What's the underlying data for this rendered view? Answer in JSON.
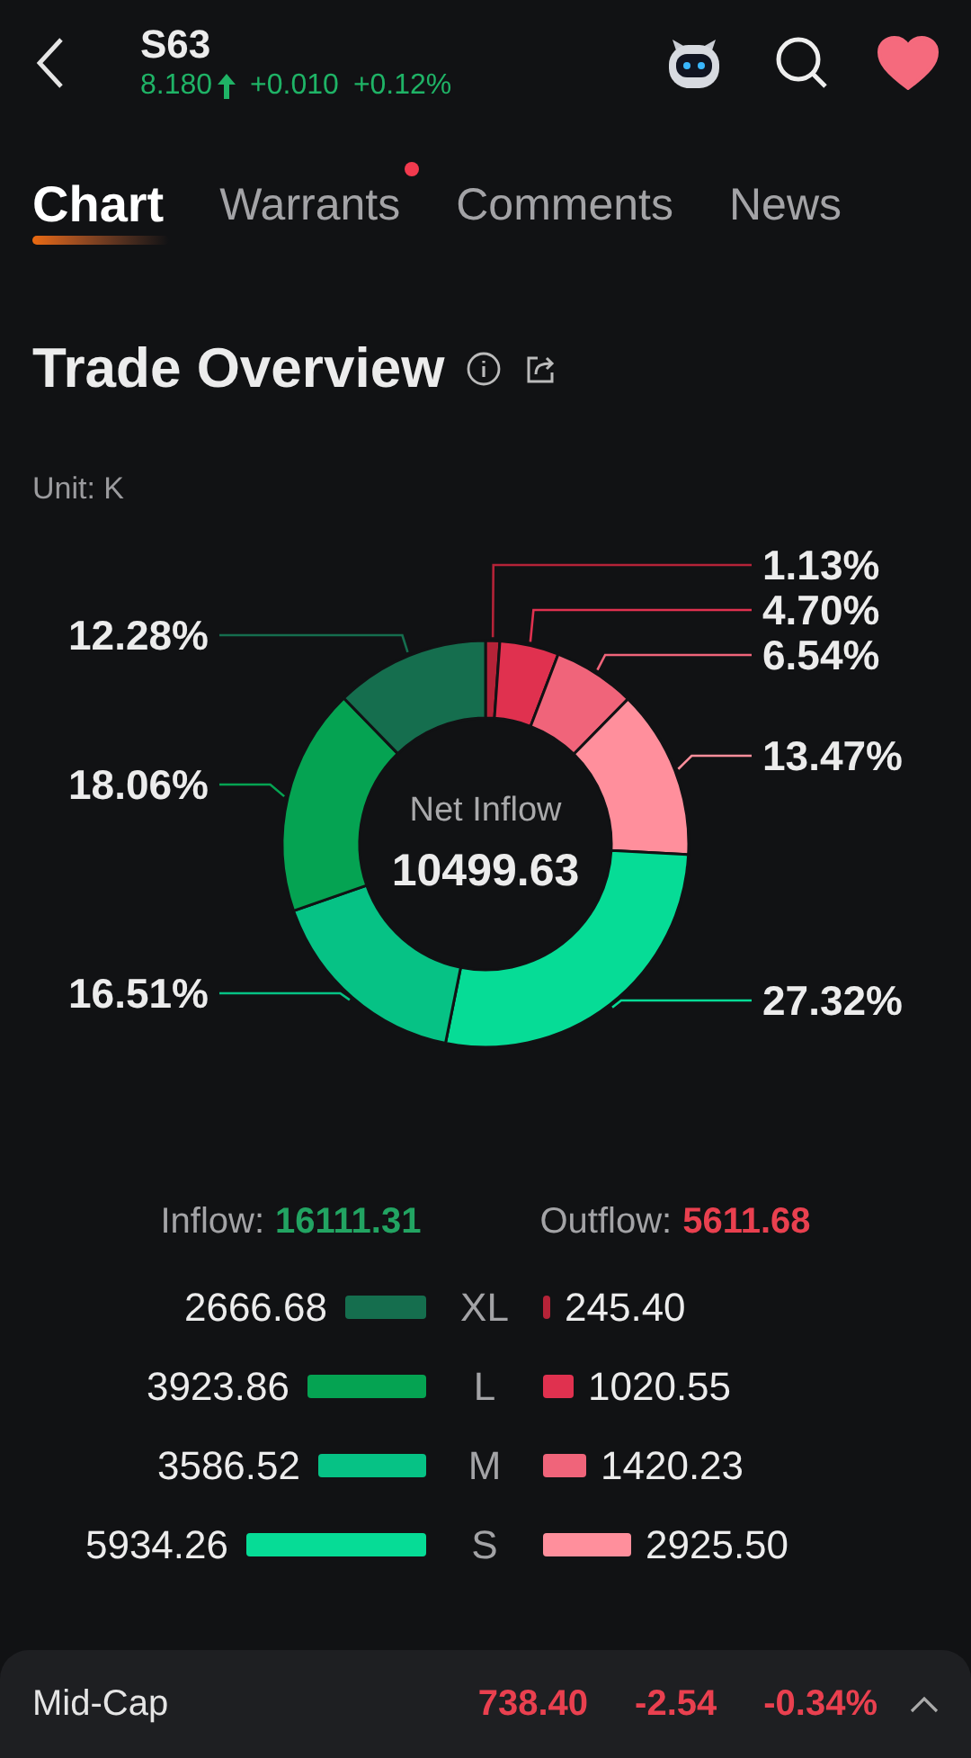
{
  "header": {
    "symbol": "S63",
    "price": "8.180",
    "change": "+0.010",
    "change_pct": "+0.12%",
    "favorite": true
  },
  "tabs": [
    {
      "label": "Chart",
      "selected": true,
      "dot": false
    },
    {
      "label": "Warrants",
      "selected": false,
      "dot": true
    },
    {
      "label": "Comments",
      "selected": false,
      "dot": false
    },
    {
      "label": "News",
      "selected": false,
      "dot": false
    }
  ],
  "section": {
    "title": "Trade Overview",
    "unit": "Unit: K"
  },
  "net_inflow": {
    "label": "Net Inflow",
    "value": "10499.63"
  },
  "chart_data": {
    "type": "donut",
    "values": [
      1.13,
      4.7,
      6.54,
      13.47,
      27.32,
      16.51,
      18.06,
      12.28
    ],
    "value_labels": [
      "1.13%",
      "4.70%",
      "6.54%",
      "13.47%",
      "27.32%",
      "16.51%",
      "18.06%",
      "12.28%"
    ],
    "colors": [
      "#b52338",
      "#e0314f",
      "#f0647a",
      "#ff8f9c",
      "#06dc96",
      "#06c285",
      "#05a352",
      "#156e4e"
    ]
  },
  "totals": {
    "inflow_label": "Inflow:",
    "inflow": "16111.31",
    "outflow_label": "Outflow:",
    "outflow": "5611.68"
  },
  "rows": [
    {
      "size": "XL",
      "inflow": {
        "value": "2666.68",
        "color": "#156e4e"
      },
      "outflow": {
        "value": "245.40",
        "color": "#b52338"
      }
    },
    {
      "size": "L",
      "inflow": {
        "value": "3923.86",
        "color": "#05a352"
      },
      "outflow": {
        "value": "1020.55",
        "color": "#e0314f"
      }
    },
    {
      "size": "M",
      "inflow": {
        "value": "3586.52",
        "color": "#06c285"
      },
      "outflow": {
        "value": "1420.23",
        "color": "#f0647a"
      }
    },
    {
      "size": "S",
      "inflow": {
        "value": "5934.26",
        "color": "#06dc96"
      },
      "outflow": {
        "value": "2925.50",
        "color": "#ff8f9c"
      }
    }
  ],
  "bottom_bar": {
    "name": "Mid-Cap",
    "price": "738.40",
    "change": "-2.54",
    "change_pct": "-0.34%",
    "expanded": false
  }
}
